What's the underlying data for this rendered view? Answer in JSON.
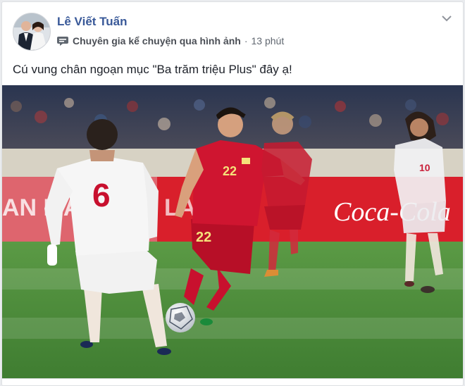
{
  "post": {
    "author": "Lê Viết Tuấn",
    "role": "Chuyên gia kể chuyện qua hình ảnh",
    "separator": "·",
    "time": "13 phút",
    "message": "Cú vung chân ngoạn mục \"Ba trăm triệu Plus\" đây ạ!"
  },
  "photo": {
    "players": [
      {
        "number": "6"
      },
      {
        "number": "22"
      },
      {
        "number": "22"
      },
      {
        "number": "10"
      }
    ],
    "ad_text": "Coca-Cola",
    "ad_text_left": "AN MA",
    "ad_text_mid": "LAON"
  },
  "colors": {
    "link": "#385898",
    "vn_red": "#c8102e",
    "uae_white": "#f4f4f4",
    "pitch": "#4d8a3a"
  }
}
